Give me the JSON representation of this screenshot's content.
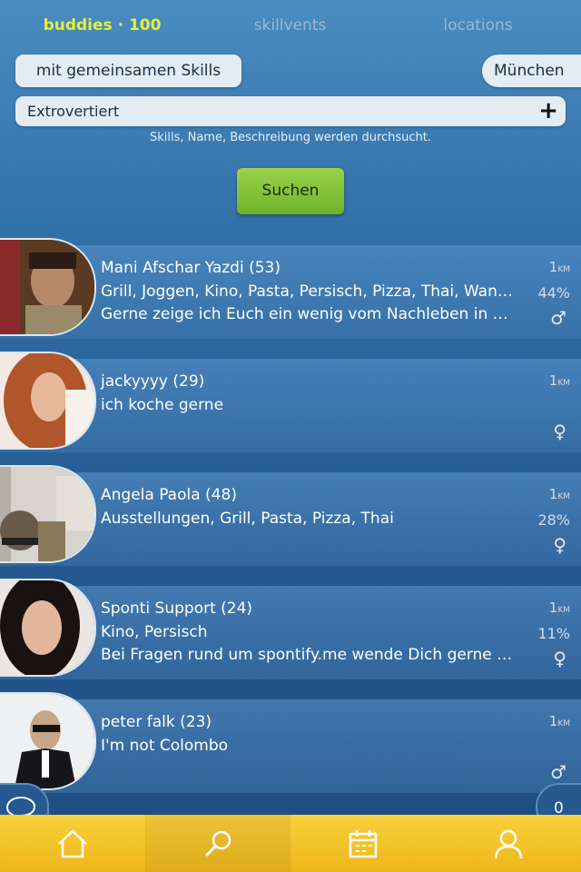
{
  "tabs": [
    {
      "label": "buddies · 100",
      "active": true
    },
    {
      "label": "skillvents",
      "active": false
    },
    {
      "label": "locations",
      "active": false
    }
  ],
  "filters": {
    "skills_filter": "mit gemeinsamen Skills",
    "city": "München",
    "trait_value": "Extrovertiert",
    "hint": "Skills, Name, Beschreibung werden durchsucht."
  },
  "search_button": "Suchen",
  "list": [
    {
      "name": "Mani Afschar Yazdi (53)",
      "line2": "Grill, Joggen, Kino, Pasta, Persisch, Pizza, Thai, Wandern",
      "line3": "Gerne zeige ich Euch ein wenig vom Nachleben in München",
      "distance": "1",
      "unit": "KM",
      "match": "44%",
      "gender": "♂"
    },
    {
      "name": "jackyyyy (29)",
      "line2": "ich koche gerne",
      "line3": "",
      "distance": "1",
      "unit": "KM",
      "match": "",
      "gender": "♀"
    },
    {
      "name": "Angela Paola (48)",
      "line2": "Ausstellungen, Grill, Pasta, Pizza, Thai",
      "line3": "",
      "distance": "1",
      "unit": "KM",
      "match": "28%",
      "gender": "♀"
    },
    {
      "name": "Sponti Support (24)",
      "line2": "Kino, Persisch",
      "line3": "Bei Fragen rund um spontify.me wende Dich gerne an uns",
      "distance": "1",
      "unit": "KM",
      "match": "11%",
      "gender": "♀"
    },
    {
      "name": "peter falk (23)",
      "line2": "I'm not Colombo",
      "line3": "",
      "distance": "1",
      "unit": "KM",
      "match": "",
      "gender": "♂"
    }
  ],
  "notification_count": "0",
  "bottom_nav": [
    "home-icon",
    "search-icon",
    "calendar-icon",
    "profile-icon"
  ]
}
